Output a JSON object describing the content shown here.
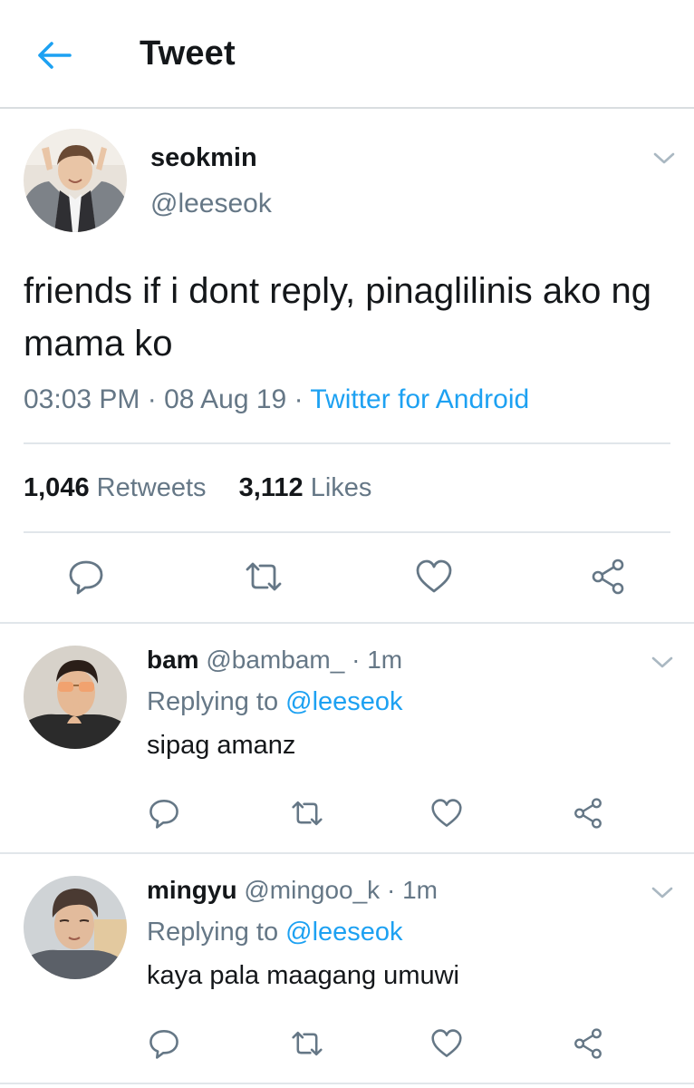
{
  "header": {
    "title": "Tweet"
  },
  "tweet": {
    "author_name": "seokmin",
    "author_handle": "@leeseok",
    "text": "friends if i dont reply, pinaglilinis ako ng mama ko",
    "time": "03:03 PM",
    "date": "08 Aug 19",
    "separator": "·",
    "source": "Twitter for Android",
    "retweets_count": "1,046",
    "retweets_label": "Retweets",
    "likes_count": "3,112",
    "likes_label": "Likes"
  },
  "replies": [
    {
      "name": "bam",
      "handle": "@bambam_",
      "time": "1m",
      "replying_prefix": "Replying to",
      "replying_to": "@leeseok",
      "text": "sipag amanz"
    },
    {
      "name": "mingyu",
      "handle": "@mingoo_k",
      "time": "1m",
      "replying_prefix": "Replying to",
      "replying_to": "@leeseok",
      "text": "kaya pala maagang umuwi"
    }
  ],
  "icons": {
    "back": "arrow-left-icon",
    "menu": "chevron-down-icon",
    "reply": "reply-icon",
    "retweet": "retweet-icon",
    "like": "heart-icon",
    "share": "share-icon"
  },
  "colors": {
    "accent": "#1da1f2",
    "text": "#14171a",
    "secondary": "#657786",
    "icon": "#657786",
    "divider": "#e1e6ea"
  }
}
